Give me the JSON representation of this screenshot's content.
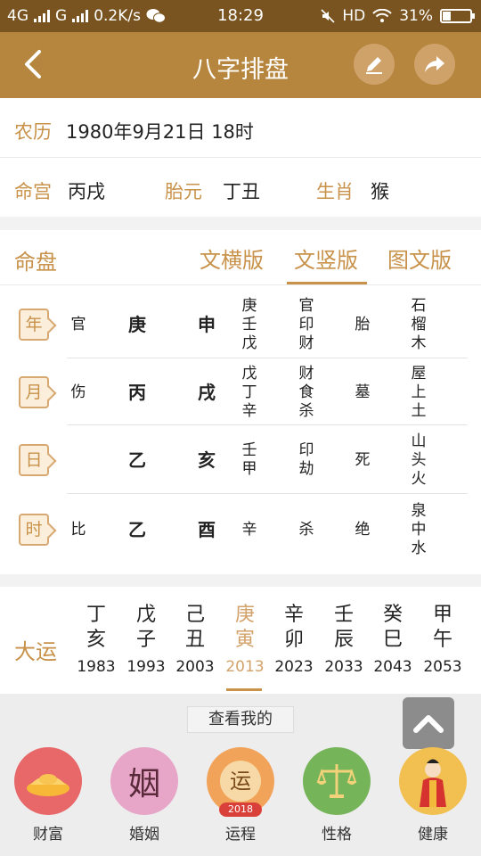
{
  "status": {
    "net1": "4G",
    "net2": "G",
    "speed": "0.2K/s",
    "time": "18:29",
    "hd": "HD",
    "battery": "31%",
    "battery_level": 0.31
  },
  "header": {
    "title": "八字排盘"
  },
  "lunar": {
    "label": "农历",
    "value": "1980年9月21日 18时"
  },
  "info": [
    {
      "label": "命宫",
      "value": "丙戌"
    },
    {
      "label": "胎元",
      "value": "丁丑"
    },
    {
      "label": "生肖",
      "value": "猴"
    }
  ],
  "chart": {
    "title": "命盘",
    "tabs": [
      "文横版",
      "文竖版",
      "图文版"
    ],
    "active_tab": "文竖版",
    "rows": [
      {
        "tag": "年",
        "shishen": "官",
        "gan": "庚",
        "zhi": "申",
        "canggan": "庚\n壬\n戊",
        "cang_shishen": "官\n印\n财",
        "changsheng": "胎",
        "nayin": "石\n榴\n木"
      },
      {
        "tag": "月",
        "shishen": "伤",
        "gan": "丙",
        "zhi": "戌",
        "canggan": "戊\n丁\n辛",
        "cang_shishen": "财\n食\n杀",
        "changsheng": "墓",
        "nayin": "屋\n上\n土"
      },
      {
        "tag": "日",
        "shishen": "",
        "gan": "乙",
        "zhi": "亥",
        "canggan": "壬\n甲",
        "cang_shishen": "印\n劫",
        "changsheng": "死",
        "nayin": "山\n头\n火"
      },
      {
        "tag": "时",
        "shishen": "比",
        "gan": "乙",
        "zhi": "酉",
        "canggan": "辛",
        "cang_shishen": "杀",
        "changsheng": "绝",
        "nayin": "泉\n中\n水"
      }
    ]
  },
  "dayun": {
    "label": "大运",
    "items": [
      {
        "g": "丁",
        "z": "亥",
        "year": "1983"
      },
      {
        "g": "戊",
        "z": "子",
        "year": "1993"
      },
      {
        "g": "己",
        "z": "丑",
        "year": "2003"
      },
      {
        "g": "庚",
        "z": "寅",
        "year": "2013"
      },
      {
        "g": "辛",
        "z": "卯",
        "year": "2023"
      },
      {
        "g": "壬",
        "z": "辰",
        "year": "2033"
      },
      {
        "g": "癸",
        "z": "巳",
        "year": "2043"
      },
      {
        "g": "甲",
        "z": "午",
        "year": "2053"
      }
    ],
    "active_index": 3
  },
  "bottom": {
    "view_label": "查看我的",
    "categories": [
      {
        "label": "财富",
        "icon": "gold-ingot-icon",
        "color": "#e8686a"
      },
      {
        "label": "婚姻",
        "icon": "marriage-character-icon",
        "color": "#e7a5c8",
        "glyph": "姻"
      },
      {
        "label": "运程",
        "icon": "fortune-coin-icon",
        "color": "#f2a35a",
        "glyph": "运",
        "badge": "2018"
      },
      {
        "label": "性格",
        "icon": "balance-scale-icon",
        "color": "#76b45a"
      },
      {
        "label": "健康",
        "icon": "doctor-figure-icon",
        "color": "#f1c050"
      }
    ]
  },
  "colors": {
    "header_bg": "#b6863f",
    "accent": "#c8924a",
    "status_bg": "#7a5420"
  }
}
